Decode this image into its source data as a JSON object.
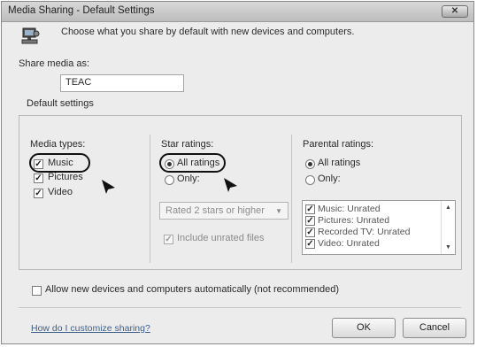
{
  "window": {
    "title": "Media Sharing - Default Settings",
    "close_label": "✕"
  },
  "header": {
    "text": "Choose what you share by default with new devices and computers."
  },
  "share": {
    "label": "Share media as:",
    "value": "TEAC"
  },
  "default_settings": {
    "label": "Default settings",
    "media_types": {
      "label": "Media types:",
      "items": [
        {
          "label": "Music",
          "checked": true
        },
        {
          "label": "Pictures",
          "checked": true
        },
        {
          "label": "Video",
          "checked": true
        }
      ]
    },
    "star_ratings": {
      "label": "Star ratings:",
      "all_label": "All ratings",
      "only_label": "Only:",
      "dropdown_value": "Rated 2 stars or higher",
      "unrated_label": "Include unrated files"
    },
    "parental_ratings": {
      "label": "Parental ratings:",
      "all_label": "All ratings",
      "only_label": "Only:",
      "list": [
        "Music: Unrated",
        "Pictures: Unrated",
        "Recorded TV: Unrated",
        "Video: Unrated"
      ]
    }
  },
  "allow_devices": {
    "label": "Allow new devices and computers automatically (not recommended)"
  },
  "footer": {
    "help_link": "How do I customize sharing?",
    "ok": "OK",
    "cancel": "Cancel"
  }
}
